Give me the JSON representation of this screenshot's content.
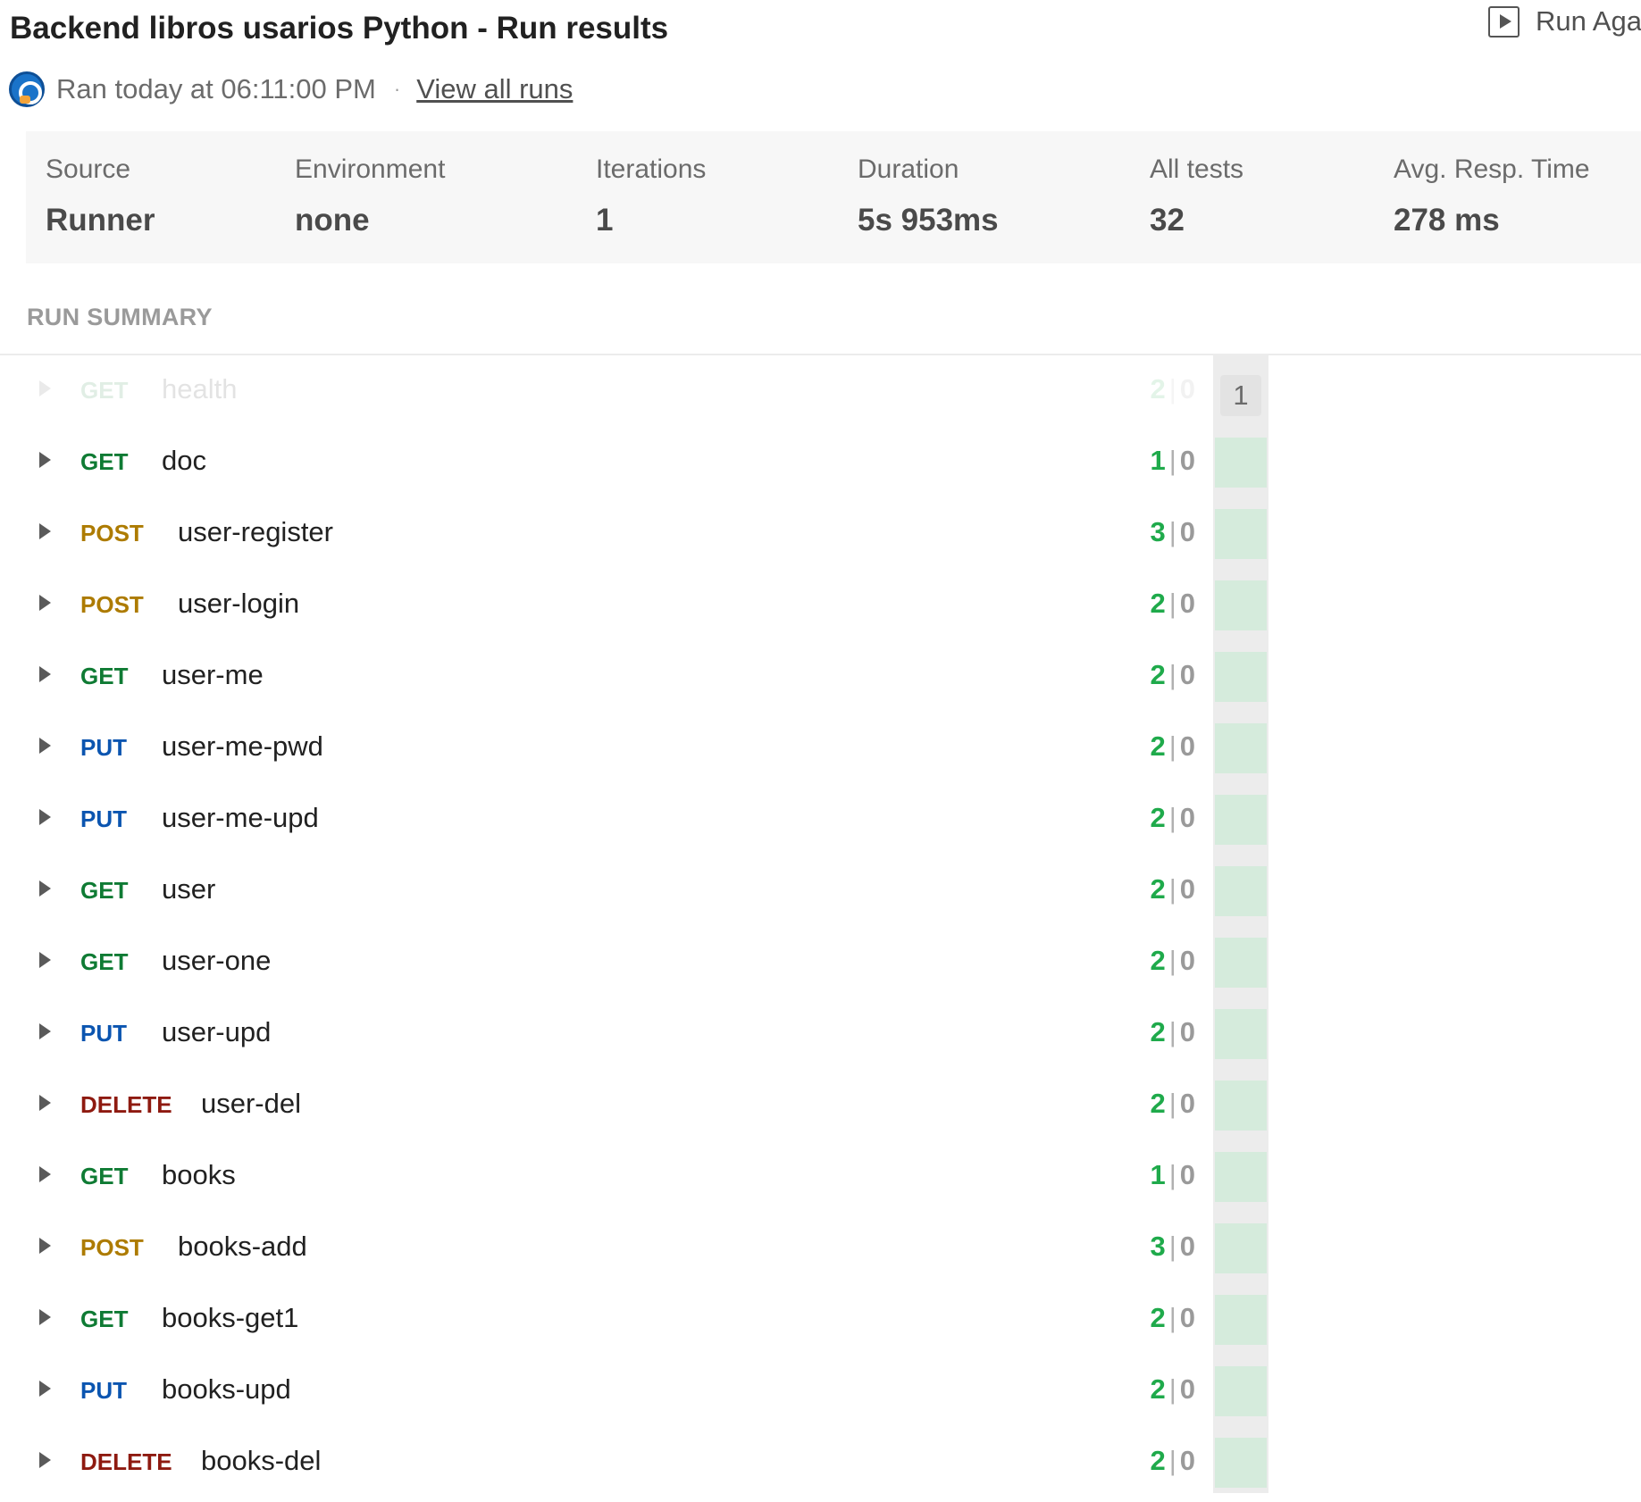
{
  "header": {
    "title": "Backend libros usarios Python - Run results",
    "run_again_label": "Run Aga"
  },
  "meta": {
    "ran_text": "Ran today at 06:11:00 PM",
    "separator": "·",
    "view_all_label": "View all runs"
  },
  "stats": {
    "source": {
      "label": "Source",
      "value": "Runner"
    },
    "environment": {
      "label": "Environment",
      "value": "none"
    },
    "iterations": {
      "label": "Iterations",
      "value": "1"
    },
    "duration": {
      "label": "Duration",
      "value": "5s 953ms"
    },
    "all_tests": {
      "label": "All tests",
      "value": "32"
    },
    "avg_resp": {
      "label": "Avg. Resp. Time",
      "value": "278 ms"
    }
  },
  "summary": {
    "header": "RUN SUMMARY",
    "iteration_label": "1",
    "requests": [
      {
        "method": "GET",
        "name": "health",
        "passed": "2",
        "failed": "0"
      },
      {
        "method": "GET",
        "name": "doc",
        "passed": "1",
        "failed": "0"
      },
      {
        "method": "POST",
        "name": "user-register",
        "passed": "3",
        "failed": "0"
      },
      {
        "method": "POST",
        "name": "user-login",
        "passed": "2",
        "failed": "0"
      },
      {
        "method": "GET",
        "name": "user-me",
        "passed": "2",
        "failed": "0"
      },
      {
        "method": "PUT",
        "name": "user-me-pwd",
        "passed": "2",
        "failed": "0"
      },
      {
        "method": "PUT",
        "name": "user-me-upd",
        "passed": "2",
        "failed": "0"
      },
      {
        "method": "GET",
        "name": "user",
        "passed": "2",
        "failed": "0"
      },
      {
        "method": "GET",
        "name": "user-one",
        "passed": "2",
        "failed": "0"
      },
      {
        "method": "PUT",
        "name": "user-upd",
        "passed": "2",
        "failed": "0"
      },
      {
        "method": "DELETE",
        "name": "user-del",
        "passed": "2",
        "failed": "0"
      },
      {
        "method": "GET",
        "name": "books",
        "passed": "1",
        "failed": "0"
      },
      {
        "method": "POST",
        "name": "books-add",
        "passed": "3",
        "failed": "0"
      },
      {
        "method": "GET",
        "name": "books-get1",
        "passed": "2",
        "failed": "0"
      },
      {
        "method": "PUT",
        "name": "books-upd",
        "passed": "2",
        "failed": "0"
      },
      {
        "method": "DELETE",
        "name": "books-del",
        "passed": "2",
        "failed": "0"
      }
    ]
  },
  "colors": {
    "GET": "#0f7b34",
    "POST": "#ad7b00",
    "PUT": "#0b55b0",
    "DELETE": "#8e1a10",
    "pass": "#1faa4b",
    "cell_pass": "#d5ebdc"
  }
}
